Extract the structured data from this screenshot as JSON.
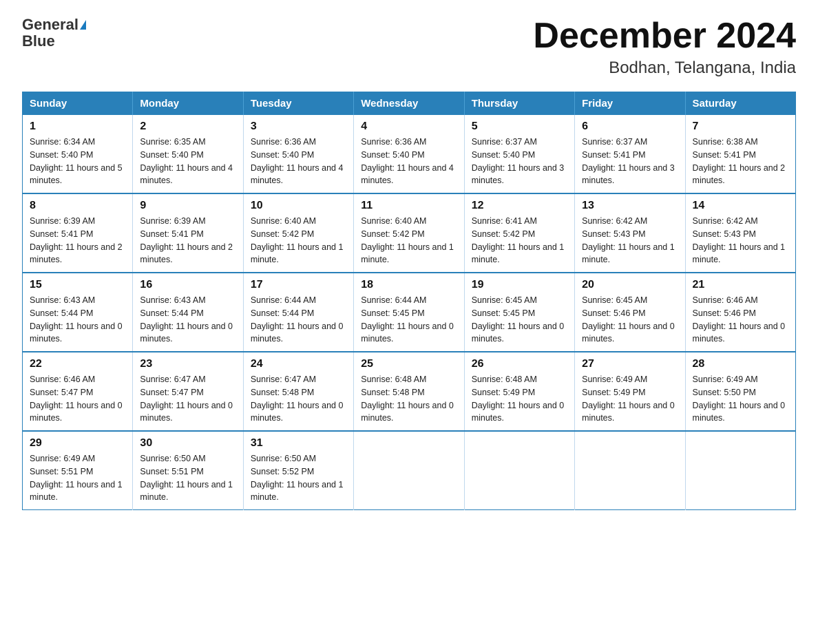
{
  "logo": {
    "text_general": "General",
    "text_blue": "Blue"
  },
  "header": {
    "title": "December 2024",
    "subtitle": "Bodhan, Telangana, India"
  },
  "weekdays": [
    "Sunday",
    "Monday",
    "Tuesday",
    "Wednesday",
    "Thursday",
    "Friday",
    "Saturday"
  ],
  "weeks": [
    [
      {
        "day": "1",
        "sunrise": "6:34 AM",
        "sunset": "5:40 PM",
        "daylight": "11 hours and 5 minutes."
      },
      {
        "day": "2",
        "sunrise": "6:35 AM",
        "sunset": "5:40 PM",
        "daylight": "11 hours and 4 minutes."
      },
      {
        "day": "3",
        "sunrise": "6:36 AM",
        "sunset": "5:40 PM",
        "daylight": "11 hours and 4 minutes."
      },
      {
        "day": "4",
        "sunrise": "6:36 AM",
        "sunset": "5:40 PM",
        "daylight": "11 hours and 4 minutes."
      },
      {
        "day": "5",
        "sunrise": "6:37 AM",
        "sunset": "5:40 PM",
        "daylight": "11 hours and 3 minutes."
      },
      {
        "day": "6",
        "sunrise": "6:37 AM",
        "sunset": "5:41 PM",
        "daylight": "11 hours and 3 minutes."
      },
      {
        "day": "7",
        "sunrise": "6:38 AM",
        "sunset": "5:41 PM",
        "daylight": "11 hours and 2 minutes."
      }
    ],
    [
      {
        "day": "8",
        "sunrise": "6:39 AM",
        "sunset": "5:41 PM",
        "daylight": "11 hours and 2 minutes."
      },
      {
        "day": "9",
        "sunrise": "6:39 AM",
        "sunset": "5:41 PM",
        "daylight": "11 hours and 2 minutes."
      },
      {
        "day": "10",
        "sunrise": "6:40 AM",
        "sunset": "5:42 PM",
        "daylight": "11 hours and 1 minute."
      },
      {
        "day": "11",
        "sunrise": "6:40 AM",
        "sunset": "5:42 PM",
        "daylight": "11 hours and 1 minute."
      },
      {
        "day": "12",
        "sunrise": "6:41 AM",
        "sunset": "5:42 PM",
        "daylight": "11 hours and 1 minute."
      },
      {
        "day": "13",
        "sunrise": "6:42 AM",
        "sunset": "5:43 PM",
        "daylight": "11 hours and 1 minute."
      },
      {
        "day": "14",
        "sunrise": "6:42 AM",
        "sunset": "5:43 PM",
        "daylight": "11 hours and 1 minute."
      }
    ],
    [
      {
        "day": "15",
        "sunrise": "6:43 AM",
        "sunset": "5:44 PM",
        "daylight": "11 hours and 0 minutes."
      },
      {
        "day": "16",
        "sunrise": "6:43 AM",
        "sunset": "5:44 PM",
        "daylight": "11 hours and 0 minutes."
      },
      {
        "day": "17",
        "sunrise": "6:44 AM",
        "sunset": "5:44 PM",
        "daylight": "11 hours and 0 minutes."
      },
      {
        "day": "18",
        "sunrise": "6:44 AM",
        "sunset": "5:45 PM",
        "daylight": "11 hours and 0 minutes."
      },
      {
        "day": "19",
        "sunrise": "6:45 AM",
        "sunset": "5:45 PM",
        "daylight": "11 hours and 0 minutes."
      },
      {
        "day": "20",
        "sunrise": "6:45 AM",
        "sunset": "5:46 PM",
        "daylight": "11 hours and 0 minutes."
      },
      {
        "day": "21",
        "sunrise": "6:46 AM",
        "sunset": "5:46 PM",
        "daylight": "11 hours and 0 minutes."
      }
    ],
    [
      {
        "day": "22",
        "sunrise": "6:46 AM",
        "sunset": "5:47 PM",
        "daylight": "11 hours and 0 minutes."
      },
      {
        "day": "23",
        "sunrise": "6:47 AM",
        "sunset": "5:47 PM",
        "daylight": "11 hours and 0 minutes."
      },
      {
        "day": "24",
        "sunrise": "6:47 AM",
        "sunset": "5:48 PM",
        "daylight": "11 hours and 0 minutes."
      },
      {
        "day": "25",
        "sunrise": "6:48 AM",
        "sunset": "5:48 PM",
        "daylight": "11 hours and 0 minutes."
      },
      {
        "day": "26",
        "sunrise": "6:48 AM",
        "sunset": "5:49 PM",
        "daylight": "11 hours and 0 minutes."
      },
      {
        "day": "27",
        "sunrise": "6:49 AM",
        "sunset": "5:49 PM",
        "daylight": "11 hours and 0 minutes."
      },
      {
        "day": "28",
        "sunrise": "6:49 AM",
        "sunset": "5:50 PM",
        "daylight": "11 hours and 0 minutes."
      }
    ],
    [
      {
        "day": "29",
        "sunrise": "6:49 AM",
        "sunset": "5:51 PM",
        "daylight": "11 hours and 1 minute."
      },
      {
        "day": "30",
        "sunrise": "6:50 AM",
        "sunset": "5:51 PM",
        "daylight": "11 hours and 1 minute."
      },
      {
        "day": "31",
        "sunrise": "6:50 AM",
        "sunset": "5:52 PM",
        "daylight": "11 hours and 1 minute."
      },
      null,
      null,
      null,
      null
    ]
  ]
}
